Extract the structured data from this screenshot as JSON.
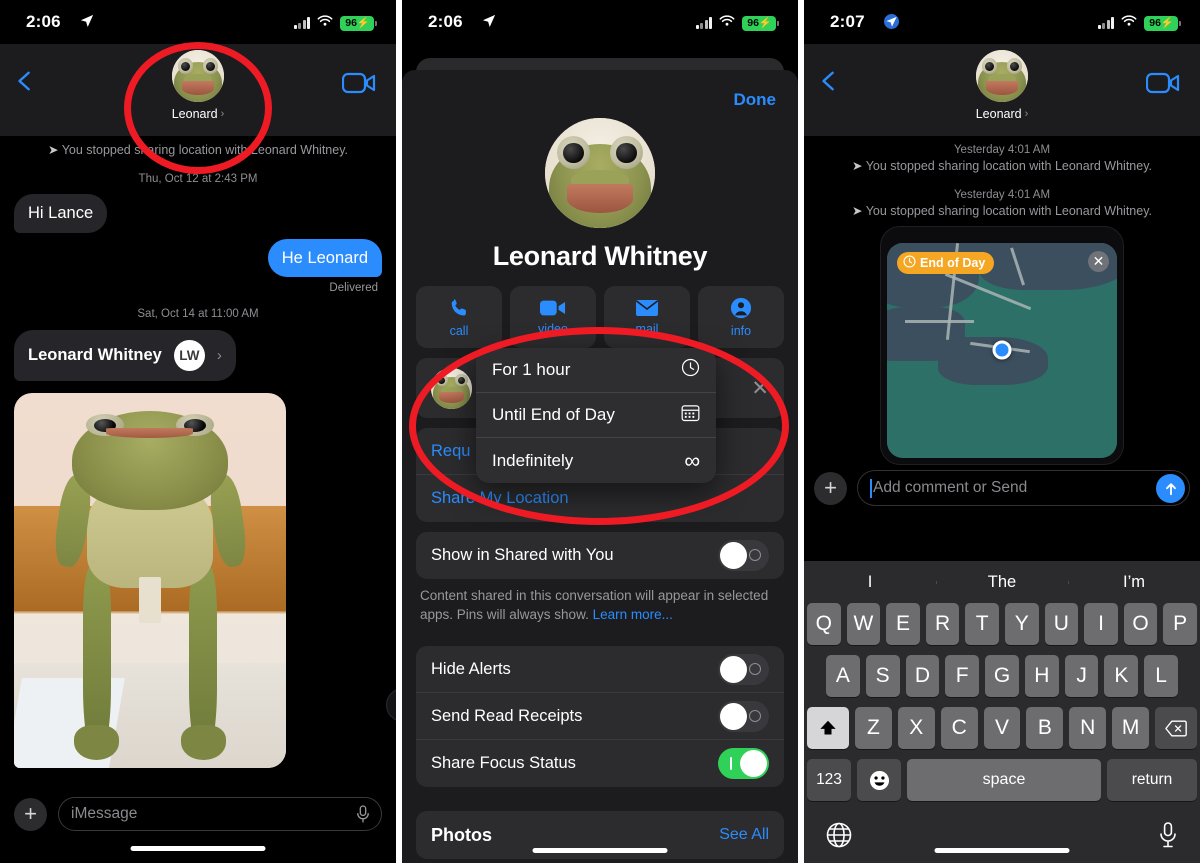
{
  "panel1": {
    "status": {
      "time": "2:06",
      "location_icon": "location-arrow-icon",
      "battery": "96",
      "wifi_icon": "wifi-icon",
      "cellular_icon": "cellular-bars-icon"
    },
    "header": {
      "back_icon": "chevron-left-icon",
      "contact_name": "Leonard",
      "chevron": "›",
      "video_icon": "video-camera-icon",
      "avatar": "frog-avatar"
    },
    "thread": {
      "system_line": "You stopped sharing location with Leonard Whitney.",
      "timestamp_1": "Thu, Oct 12 at 2:43 PM",
      "message_in": "Hi Lance",
      "message_out": "He Leonard",
      "delivered": "Delivered",
      "timestamp_2": "Sat, Oct 14 at 11:00 AM",
      "contact_card_name": "Leonard Whitney",
      "contact_card_initials": "LW",
      "contact_card_chevron": "›",
      "download_icon": "download-icon",
      "photo_alt": "frog-plush-photo"
    },
    "composer": {
      "plus_icon": "plus-icon",
      "placeholder": "iMessage",
      "mic_icon": "microphone-icon"
    }
  },
  "panel2": {
    "status": {
      "time": "2:06",
      "battery": "96"
    },
    "sheet": {
      "done_label": "Done",
      "contact_name": "Leonard Whitney",
      "actions": [
        {
          "icon": "phone-icon",
          "label": "call"
        },
        {
          "icon": "video-camera-icon",
          "label": "video"
        },
        {
          "icon": "mail-icon",
          "label": "mail"
        },
        {
          "icon": "person-circle-icon",
          "label": "info"
        }
      ],
      "location_row": {
        "avatar": "frog-avatar",
        "close_icon": "close-x-icon"
      },
      "request_label": "Requ",
      "share_my_location_label": "Share My Location",
      "show_in_shared": {
        "label": "Show in Shared with You",
        "on": false
      },
      "note_text": "Content shared in this conversation will appear in selected apps. Pins will always show. ",
      "note_link": "Learn more...",
      "hide_alerts": {
        "label": "Hide Alerts",
        "on": false
      },
      "send_read_receipts": {
        "label": "Send Read Receipts",
        "on": false
      },
      "share_focus_status": {
        "label": "Share Focus Status",
        "on": true
      },
      "photos_title": "Photos",
      "see_all": "See All"
    },
    "popup": {
      "items": [
        {
          "label": "For 1 hour",
          "icon": "clock-icon"
        },
        {
          "label": "Until End of Day",
          "icon": "calendar-icon"
        },
        {
          "label": "Indefinitely",
          "icon": "infinity-icon"
        }
      ]
    }
  },
  "panel3": {
    "status": {
      "time": "2:07",
      "battery": "96"
    },
    "header": {
      "back_icon": "chevron-left-icon",
      "contact_name": "Leonard",
      "chevron": "›",
      "video_icon": "video-camera-icon"
    },
    "thread": {
      "timestamp_1": "Yesterday 4:01 AM",
      "system_line_1": "You stopped sharing location with Leonard Whitney.",
      "timestamp_2": "Yesterday 4:01 AM",
      "system_line_2": "You stopped sharing location with Leonard Whitney."
    },
    "map": {
      "badge_label": "End of Day",
      "badge_icon": "clock-icon",
      "close_icon": "close-x-icon",
      "user_dot": "blue-location-dot"
    },
    "composer": {
      "plus_icon": "plus-icon",
      "placeholder": "Add comment or Send",
      "send_icon": "arrow-up-icon"
    },
    "keyboard": {
      "predictions": [
        "I",
        "The",
        "I’m"
      ],
      "row1": [
        "Q",
        "W",
        "E",
        "R",
        "T",
        "Y",
        "U",
        "I",
        "O",
        "P"
      ],
      "row2": [
        "A",
        "S",
        "D",
        "F",
        "G",
        "H",
        "J",
        "K",
        "L"
      ],
      "row3": [
        "Z",
        "X",
        "C",
        "V",
        "B",
        "N",
        "M"
      ],
      "shift_icon": "shift-up-icon",
      "backspace_icon": "backspace-icon",
      "numbers_label": "123",
      "emoji_icon": "emoji-smiley-icon",
      "space_label": "space",
      "return_label": "return",
      "globe_icon": "globe-icon",
      "dictation_icon": "microphone-icon"
    }
  },
  "colors": {
    "accent_blue": "#2b8cfe",
    "green": "#30d158",
    "orange": "#f5a623",
    "annotation_red": "#ee1b24"
  }
}
